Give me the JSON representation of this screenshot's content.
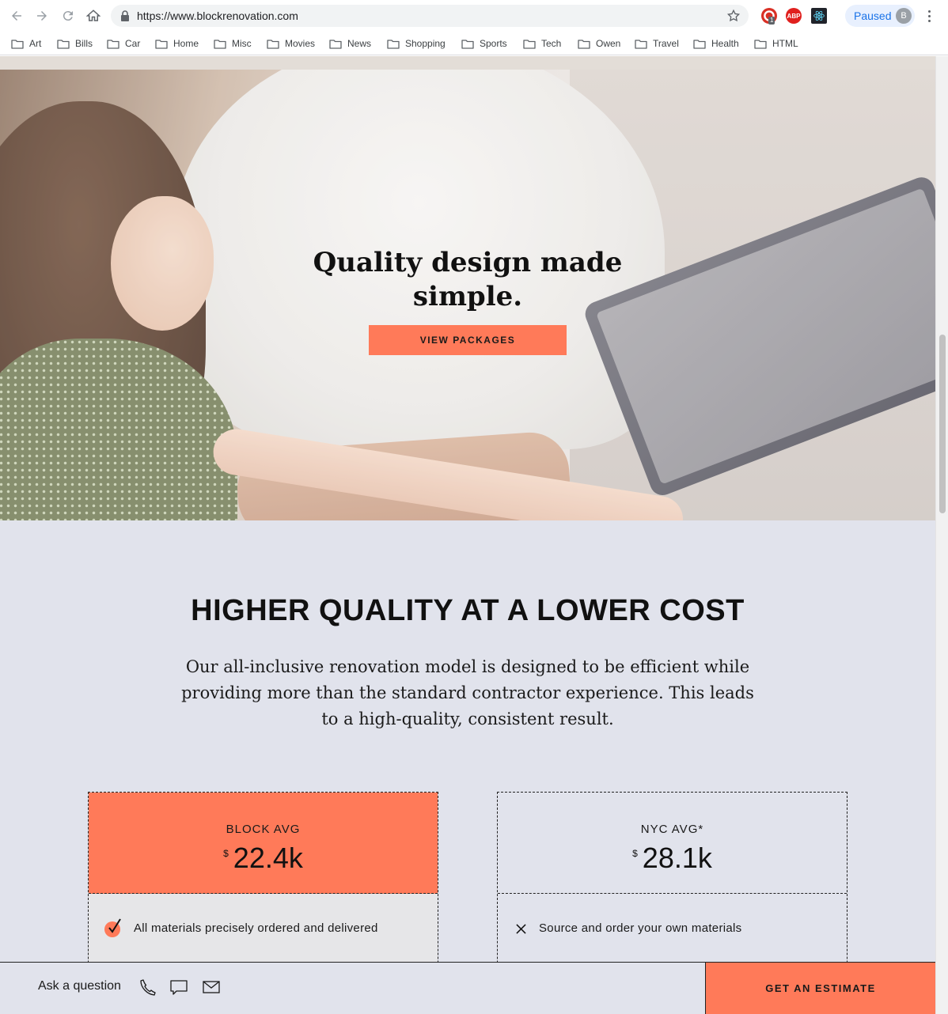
{
  "browser": {
    "url": "https://www.blockrenovation.com",
    "profile_status": "Paused",
    "profile_initial": "B",
    "extension_badge": "1",
    "abp_label": "ABP",
    "bookmarks": [
      "Art",
      "Bills",
      "Car",
      "Home",
      "Misc",
      "Movies",
      "News",
      "Shopping",
      "Sports",
      "Tech",
      "Owen",
      "Travel",
      "Health",
      "HTML"
    ]
  },
  "hero": {
    "title": "Quality design made simple.",
    "button_label": "VIEW PACKAGES"
  },
  "section": {
    "title": "HIGHER QUALITY AT A LOWER COST",
    "description": "Our all-inclusive renovation model is designed to be efficient while providing more than the standard contractor experience. This leads to a high-quality, consistent result."
  },
  "comparison": {
    "block": {
      "label": "BLOCK AVG",
      "currency": "$",
      "value": "22.4k",
      "feature": "All materials precisely ordered and delivered"
    },
    "nyc": {
      "label": "NYC AVG*",
      "currency": "$",
      "value": "28.1k",
      "feature": "Source and order your own materials"
    }
  },
  "footer": {
    "ask_label": "Ask a question",
    "estimate_label": "GET AN ESTIMATE"
  },
  "colors": {
    "accent": "#ff7a59",
    "section_bg": "#e1e3ec"
  }
}
